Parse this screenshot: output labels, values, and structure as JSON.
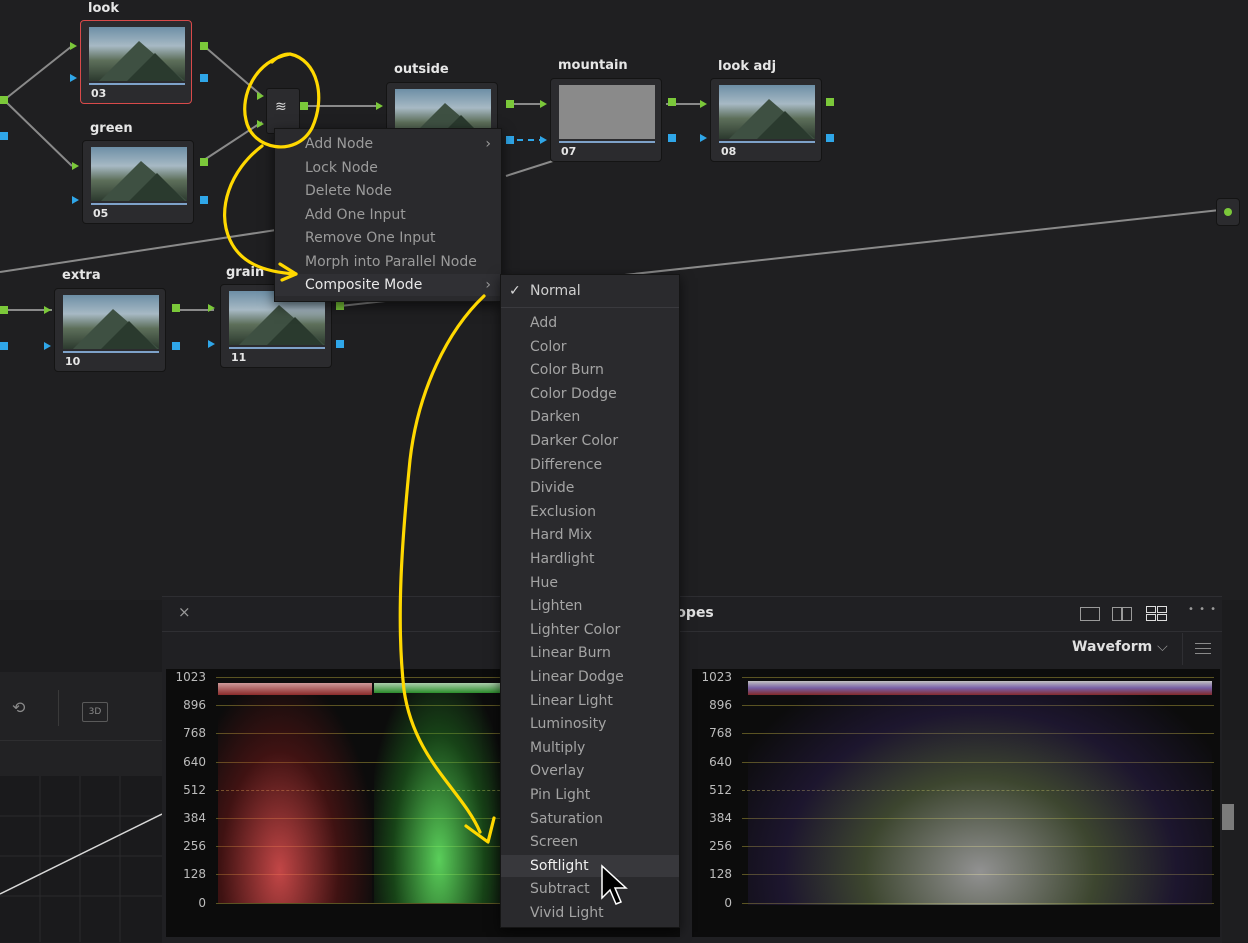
{
  "node_graph": {
    "nodes": [
      {
        "label": "look",
        "number": "03"
      },
      {
        "label": "green",
        "number": "05"
      },
      {
        "label": "outside",
        "number": ""
      },
      {
        "label": "mountain",
        "number": "07"
      },
      {
        "label": "look adj",
        "number": "08"
      },
      {
        "label": "extra",
        "number": "10"
      },
      {
        "label": "grain",
        "number": "11"
      }
    ],
    "layer_mixer_icon": "parallel-mixer-icon"
  },
  "context_menu": {
    "items": [
      {
        "label": "Add Node",
        "submenu": true,
        "enabled": false
      },
      {
        "label": "Lock Node",
        "enabled": false
      },
      {
        "label": "Delete Node",
        "enabled": false
      },
      {
        "label": "Add One Input",
        "enabled": false
      },
      {
        "label": "Remove One Input",
        "enabled": false
      },
      {
        "label": "Morph into Parallel Node",
        "enabled": false
      },
      {
        "label": "Composite Mode",
        "submenu": true,
        "enabled": true
      }
    ],
    "arrow_glyph": "›"
  },
  "composite_submenu": {
    "checked": "Normal",
    "checkmark": "✓",
    "items": [
      "Normal",
      "Add",
      "Color",
      "Color Burn",
      "Color Dodge",
      "Darken",
      "Darker Color",
      "Difference",
      "Divide",
      "Exclusion",
      "Hard Mix",
      "Hardlight",
      "Hue",
      "Lighten",
      "Lighter Color",
      "Linear Burn",
      "Linear Dodge",
      "Linear Light",
      "Luminosity",
      "Multiply",
      "Overlay",
      "Pin Light",
      "Saturation",
      "Screen",
      "Softlight",
      "Subtract",
      "Vivid Light"
    ],
    "hovered": "Softlight"
  },
  "scopes": {
    "title": "copes",
    "close_glyph": "×",
    "scope_type": "Waveform",
    "more_glyph": "• • •",
    "y_ticks": [
      "1023",
      "896",
      "768",
      "640",
      "512",
      "384",
      "256",
      "128",
      "0"
    ]
  },
  "left_panel": {
    "badge_3d": "3D"
  },
  "colors": {
    "port_green": "#7bc83a",
    "port_blue": "#2fa6e8",
    "annotation_yellow": "#ffd800",
    "selected_border": "#d94a4a"
  }
}
